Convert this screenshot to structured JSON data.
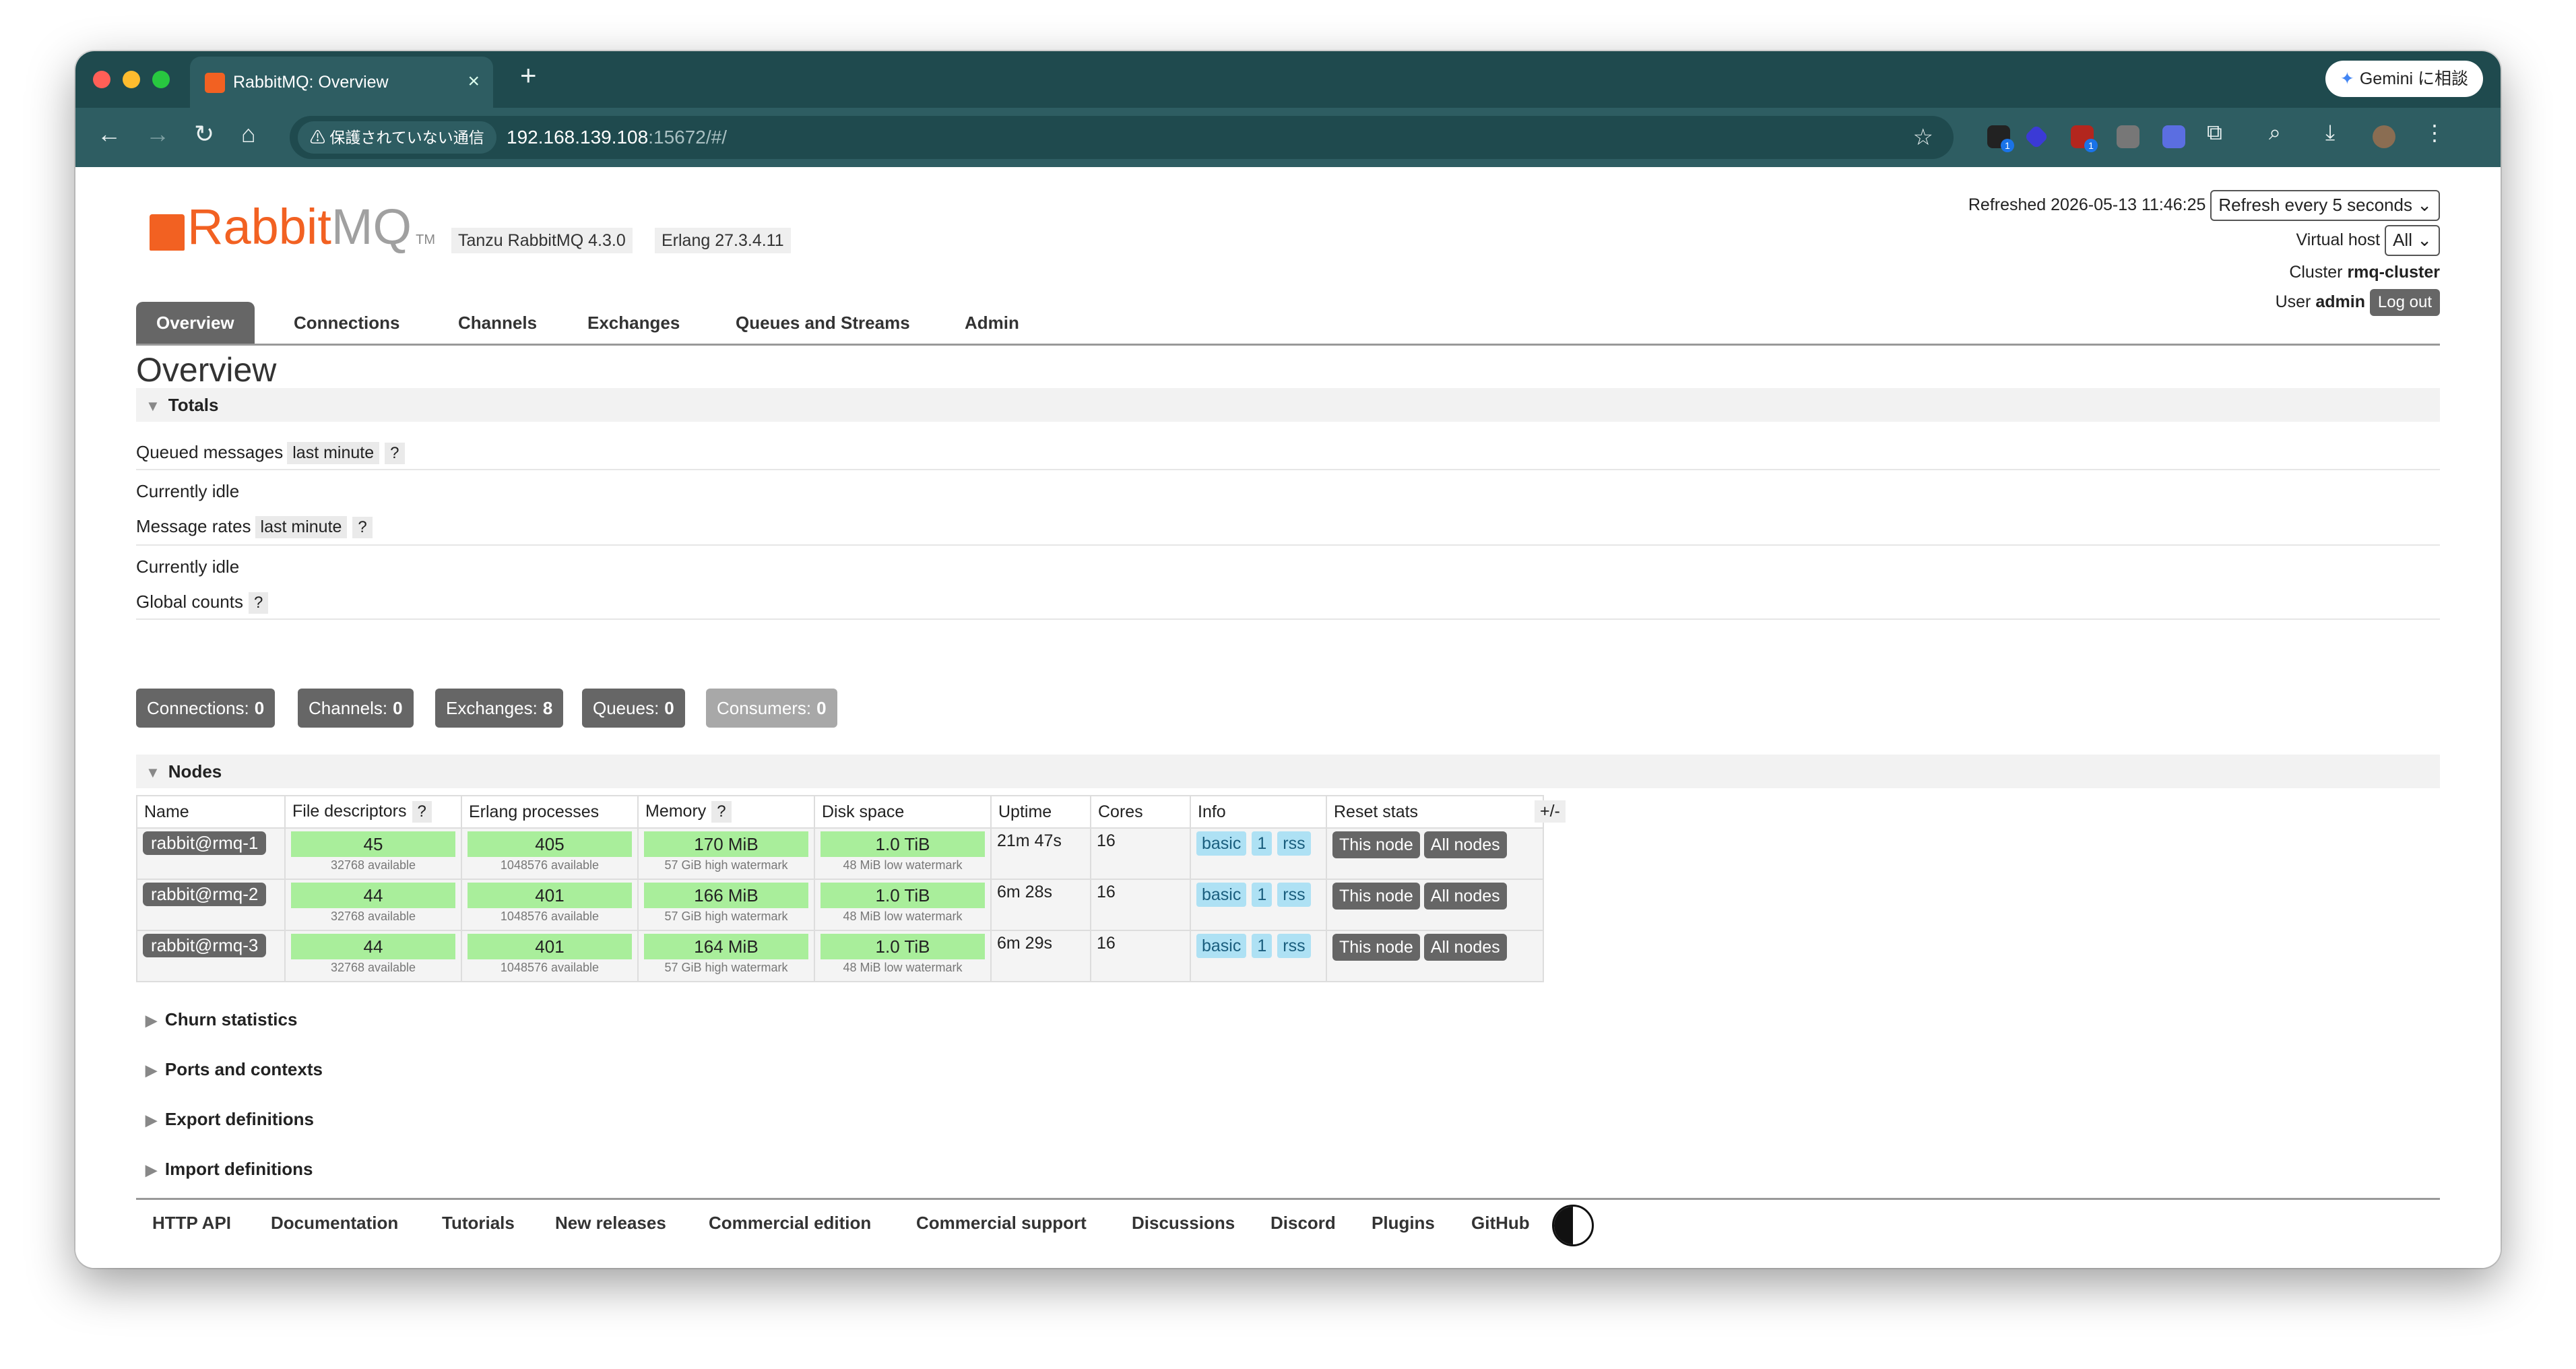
{
  "browser": {
    "tab_title": "RabbitMQ: Overview",
    "tab_close": "×",
    "new_tab": "+",
    "gemini_label": "Gemini に相談",
    "security_label": "保護されていない通信",
    "url_host": "192.168.139.108",
    "url_rest": ":15672/#/",
    "icons": [
      "back-arrow-icon",
      "forward-arrow-icon",
      "reload-icon",
      "home-icon",
      "warning-icon",
      "star-icon",
      "extension-icon",
      "download-icon",
      "profile-avatar",
      "more-vert-icon"
    ]
  },
  "header": {
    "logo_rabbit": "Rabbit",
    "logo_mq": "MQ",
    "logo_tm": "TM",
    "product_version": "Tanzu RabbitMQ 4.3.0",
    "erlang_version": "Erlang 27.3.4.11",
    "refreshed_label": "Refreshed 2026-05-13 11:46:25",
    "refresh_select": "Refresh every 5 seconds",
    "vhost_label": "Virtual host",
    "vhost_value": "All",
    "cluster_label": "Cluster",
    "cluster_name": "rmq-cluster",
    "user_label": "User",
    "user_name": "admin",
    "logout": "Log out"
  },
  "nav_tabs": [
    "Overview",
    "Connections",
    "Channels",
    "Exchanges",
    "Queues and Streams",
    "Admin"
  ],
  "page_title": "Overview",
  "totals": {
    "heading": "Totals",
    "queued_label": "Queued messages",
    "queued_window": "last minute",
    "help": "?",
    "idle1": "Currently idle",
    "rates_label": "Message rates",
    "rates_window": "last minute",
    "idle2": "Currently idle",
    "global_label": "Global counts"
  },
  "counts": [
    {
      "label": "Connections:",
      "value": "0"
    },
    {
      "label": "Channels:",
      "value": "0"
    },
    {
      "label": "Exchanges:",
      "value": "8"
    },
    {
      "label": "Queues:",
      "value": "0"
    },
    {
      "label": "Consumers:",
      "value": "0"
    }
  ],
  "nodes": {
    "heading": "Nodes",
    "columns": [
      "Name",
      "File descriptors",
      "Erlang processes",
      "Memory",
      "Disk space",
      "Uptime",
      "Cores",
      "Info",
      "Reset stats"
    ],
    "plusminus": "+/-",
    "rows": [
      {
        "name": "rabbit@rmq-1",
        "fd": "45",
        "fd_sub": "32768 available",
        "proc": "405",
        "proc_sub": "1048576 available",
        "mem": "170 MiB",
        "mem_sub": "57 GiB high watermark",
        "disk": "1.0 TiB",
        "disk_sub": "48 MiB low watermark",
        "uptime": "21m 47s",
        "cores": "16"
      },
      {
        "name": "rabbit@rmq-2",
        "fd": "44",
        "fd_sub": "32768 available",
        "proc": "401",
        "proc_sub": "1048576 available",
        "mem": "166 MiB",
        "mem_sub": "57 GiB high watermark",
        "disk": "1.0 TiB",
        "disk_sub": "48 MiB low watermark",
        "uptime": "6m 28s",
        "cores": "16"
      },
      {
        "name": "rabbit@rmq-3",
        "fd": "44",
        "fd_sub": "32768 available",
        "proc": "401",
        "proc_sub": "1048576 available",
        "mem": "164 MiB",
        "mem_sub": "57 GiB high watermark",
        "disk": "1.0 TiB",
        "disk_sub": "48 MiB low watermark",
        "uptime": "6m 29s",
        "cores": "16"
      }
    ],
    "info_basic": "basic",
    "info_one": "1",
    "info_rss": "rss",
    "btn_this": "This node",
    "btn_all": "All nodes"
  },
  "collapsed_sections": [
    "Churn statistics",
    "Ports and contexts",
    "Export definitions",
    "Import definitions"
  ],
  "footer_links": [
    "HTTP API",
    "Documentation",
    "Tutorials",
    "New releases",
    "Commercial edition",
    "Commercial support",
    "Discussions",
    "Discord",
    "Plugins",
    "GitHub"
  ],
  "colors": {
    "brand": "#f26122",
    "chrome": "#1f4a4e",
    "gauge_green": "#a9ee9b",
    "info_blue": "#aee1f4"
  }
}
